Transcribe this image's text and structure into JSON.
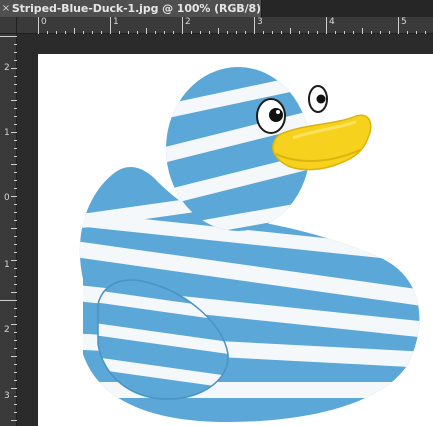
{
  "document_tab": {
    "close_symbol": "×",
    "title": "Striped-Blue-Duck-1.jpg @ 100% (RGB/8)"
  },
  "rulers": {
    "top_labels": [
      "0",
      "1",
      "2",
      "3",
      "4",
      "5"
    ],
    "left_labels": [
      "2",
      "1",
      "0",
      "1",
      "2",
      "3"
    ]
  },
  "canvas": {
    "image_subject": "striped blue rubber duck",
    "colors": {
      "background": "#2b2b2b",
      "document": "#ffffff",
      "duck_blue": "#5aa7d8",
      "duck_stripe": "#f4f8fb",
      "beak": "#f6d21e"
    }
  }
}
